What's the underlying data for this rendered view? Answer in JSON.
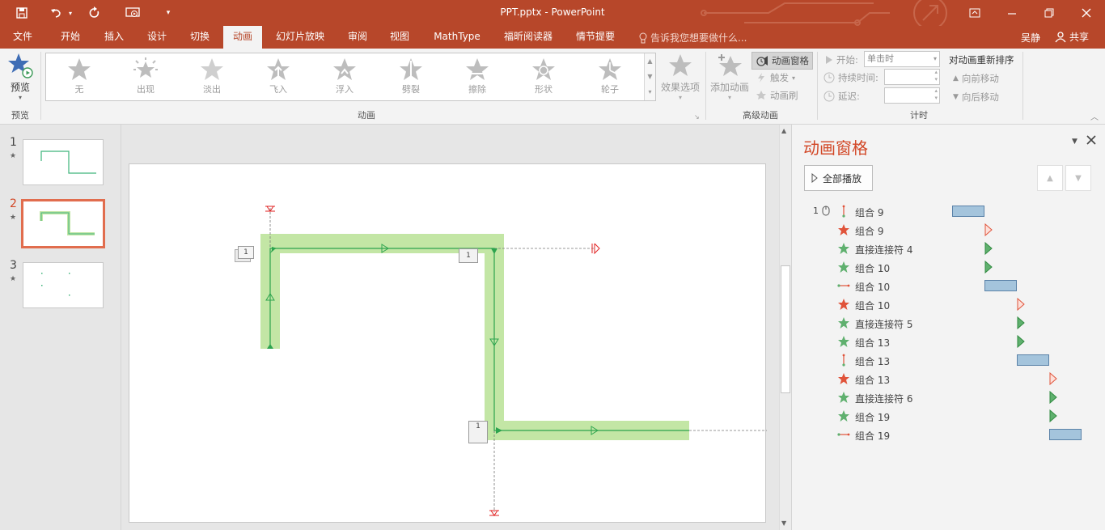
{
  "titlebar": {
    "title": "PPT.pptx - PowerPoint",
    "user": "吴静",
    "share": "共享"
  },
  "tabs": [
    {
      "label": "文件"
    },
    {
      "label": "开始"
    },
    {
      "label": "插入"
    },
    {
      "label": "设计"
    },
    {
      "label": "切换"
    },
    {
      "label": "动画"
    },
    {
      "label": "幻灯片放映"
    },
    {
      "label": "审阅"
    },
    {
      "label": "视图"
    },
    {
      "label": "MathType"
    },
    {
      "label": "福昕阅读器"
    },
    {
      "label": "情节提要"
    }
  ],
  "tell_me": "告诉我您想要做什么...",
  "ribbon": {
    "preview": {
      "button": "预览",
      "group": "预览"
    },
    "gallery": {
      "group": "动画",
      "items": [
        {
          "label": "无"
        },
        {
          "label": "出现"
        },
        {
          "label": "淡出"
        },
        {
          "label": "飞入"
        },
        {
          "label": "浮入"
        },
        {
          "label": "劈裂"
        },
        {
          "label": "擦除"
        },
        {
          "label": "形状"
        },
        {
          "label": "轮子"
        }
      ],
      "effect_options": "效果选项"
    },
    "advanced": {
      "group": "高级动画",
      "add_animation": "添加动画",
      "animation_pane": "动画窗格",
      "trigger": "触发",
      "painter": "动画刷"
    },
    "timing": {
      "group": "计时",
      "start_label": "开始:",
      "start_value": "单击时",
      "duration_label": "持续时间:",
      "delay_label": "延迟:",
      "reorder": "对动画重新排序",
      "move_earlier": "向前移动",
      "move_later": "向后移动"
    }
  },
  "slides": [
    {
      "num": "1"
    },
    {
      "num": "2"
    },
    {
      "num": "3"
    }
  ],
  "slide_tags": [
    "1",
    "1",
    "1"
  ],
  "pane": {
    "title": "动画窗格",
    "play_all": "全部播放",
    "first_index": "1",
    "items": [
      {
        "label": "组合 9",
        "icon": "motion-path-vertical",
        "bar": {
          "kind": "motion",
          "start": 0.0,
          "end": 1.0
        }
      },
      {
        "label": "组合 9",
        "icon": "exit-star",
        "bar": {
          "kind": "exit",
          "start": 1.0
        }
      },
      {
        "label": "直接连接符 4",
        "icon": "entrance-star",
        "bar": {
          "kind": "entrance",
          "start": 1.0
        }
      },
      {
        "label": "组合 10",
        "icon": "entrance-star",
        "bar": {
          "kind": "entrance",
          "start": 1.0
        }
      },
      {
        "label": "组合 10",
        "icon": "motion-path-horizontal",
        "bar": {
          "kind": "motion",
          "start": 1.0,
          "end": 2.0
        }
      },
      {
        "label": "组合 10",
        "icon": "exit-star",
        "bar": {
          "kind": "exit",
          "start": 2.0
        }
      },
      {
        "label": "直接连接符 5",
        "icon": "entrance-star",
        "bar": {
          "kind": "entrance",
          "start": 2.0
        }
      },
      {
        "label": "组合 13",
        "icon": "entrance-star",
        "bar": {
          "kind": "entrance",
          "start": 2.0
        }
      },
      {
        "label": "组合 13",
        "icon": "motion-path-vertical",
        "bar": {
          "kind": "motion",
          "start": 2.0,
          "end": 3.0
        }
      },
      {
        "label": "组合 13",
        "icon": "exit-star",
        "bar": {
          "kind": "exit",
          "start": 3.0
        }
      },
      {
        "label": "直接连接符 6",
        "icon": "entrance-star",
        "bar": {
          "kind": "entrance",
          "start": 3.0
        }
      },
      {
        "label": "组合 19",
        "icon": "entrance-star",
        "bar": {
          "kind": "entrance",
          "start": 3.0
        }
      },
      {
        "label": "组合 19",
        "icon": "motion-path-horizontal",
        "bar": {
          "kind": "motion",
          "start": 3.0,
          "end": 4.0
        }
      }
    ]
  },
  "colors": {
    "accent": "#b7472a",
    "entrance": "#5fb06e",
    "exit": "#e0533a",
    "path": "#2da44e",
    "highlight": "#c3e6a5"
  }
}
